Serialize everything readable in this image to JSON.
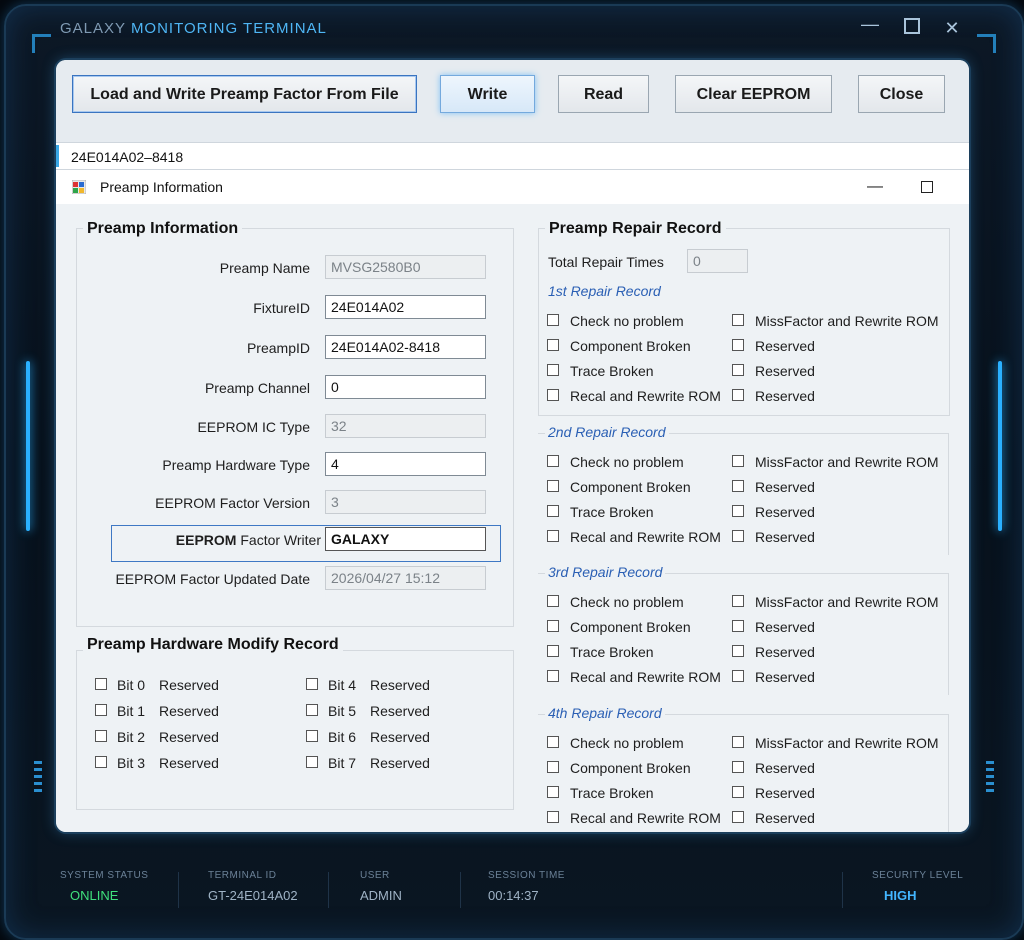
{
  "window": {
    "title_left": "GALAXY",
    "title_right": "MONITORING TERMINAL",
    "min_glyph": "—",
    "close_glyph": "✕"
  },
  "toolbar": {
    "load_label": "Load and Write Preamp Factor From File",
    "write_label": "Write",
    "read_label": "Read",
    "clear_label": "Clear EEPROM",
    "close_label": "Close"
  },
  "serial": "24E014A02–8418",
  "subwindow": {
    "title": "Preamp Information",
    "min_glyph": "—"
  },
  "preamp_info": {
    "group_title": "Preamp Information",
    "fields": [
      {
        "label": "Preamp Name",
        "value": "MVSG2580B0",
        "readonly": true
      },
      {
        "label": "FixtureID",
        "value": "24E014A02",
        "readonly": false
      },
      {
        "label": "PreampID",
        "value": "24E014A02-8418",
        "readonly": false
      },
      {
        "label": "Preamp Channel",
        "value": "0",
        "readonly": false
      },
      {
        "label": "EEPROM IC Type",
        "value": "32",
        "readonly": true
      },
      {
        "label": "Preamp Hardware Type",
        "value": "4",
        "readonly": false
      },
      {
        "label": "EEPROM Factor Version",
        "value": "3",
        "readonly": true
      },
      {
        "label_bold": "EEPROM",
        "label_rest": " Factor Writer",
        "value": "GALAXY",
        "readonly": false
      },
      {
        "label": "EEPROM Factor Updated Date",
        "value": "2026/04/27 15:12",
        "readonly": true
      }
    ]
  },
  "hw_modify": {
    "group_title": "Preamp Hardware Modify Record",
    "bits": [
      {
        "bit": "Bit 0",
        "text": "Reserved"
      },
      {
        "bit": "Bit 1",
        "text": "Reserved"
      },
      {
        "bit": "Bit 2",
        "text": "Reserved"
      },
      {
        "bit": "Bit 3",
        "text": "Reserved"
      },
      {
        "bit": "Bit 4",
        "text": "Reserved"
      },
      {
        "bit": "Bit 5",
        "text": "Reserved"
      },
      {
        "bit": "Bit 6",
        "text": "Reserved"
      },
      {
        "bit": "Bit 7",
        "text": "Reserved"
      }
    ]
  },
  "repair": {
    "group_title": "Preamp Repair Record",
    "total_label": "Total Repair Times",
    "total_value": "0",
    "records": [
      {
        "title": "1st Repair Record"
      },
      {
        "title": "2nd Repair Record"
      },
      {
        "title": "3rd Repair Record"
      },
      {
        "title": "4th Repair Record"
      }
    ],
    "left_items": [
      "Check no problem",
      "Component Broken",
      "Trace Broken",
      "Recal and Rewrite ROM"
    ],
    "right_items": [
      "MissFactor and Rewrite ROM",
      "Reserved",
      "Reserved",
      "Reserved"
    ]
  },
  "statusbar": {
    "system_status_label": "SYSTEM STATUS",
    "system_status_value": "ONLINE",
    "terminal_id_label": "TERMINAL ID",
    "terminal_id_value": "GT-24E014A02",
    "user_label": "USER",
    "user_value": "ADMIN",
    "session_label": "SESSION TIME",
    "session_value": "00:14:37",
    "security_label": "SECURITY LEVEL",
    "security_value": "HIGH"
  },
  "colors": {
    "accent": "#4fb6f5",
    "online": "#3fe07c",
    "repair_title": "#2a5fb4",
    "frame_bg": "#07111c",
    "panel_bg": "#e9eef3"
  }
}
